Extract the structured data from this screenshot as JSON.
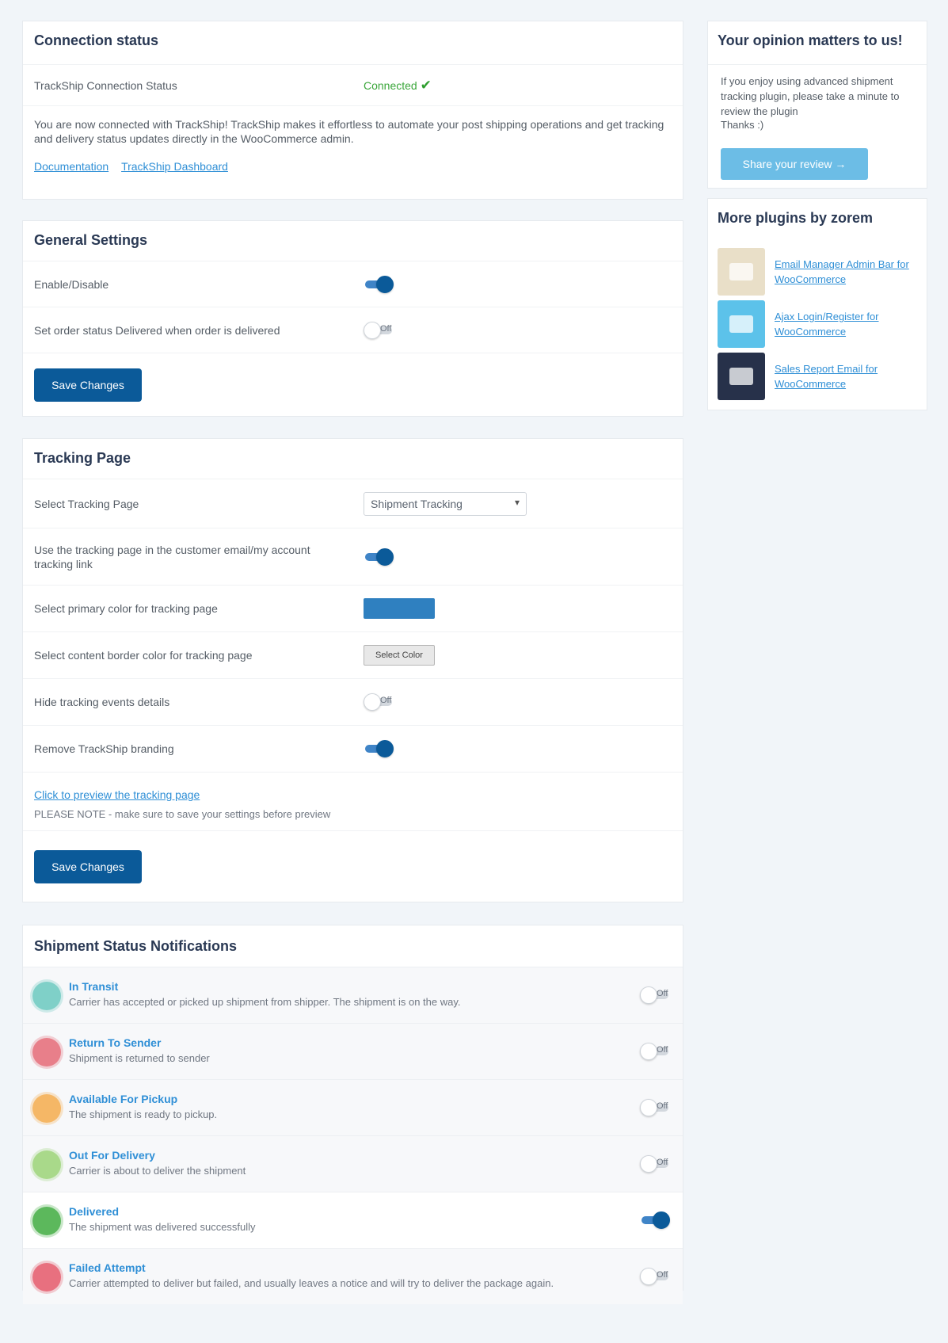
{
  "connection": {
    "title": "Connection status",
    "status_label": "TrackShip Connection Status",
    "status_value": "Connected",
    "description": "You are now connected with TrackShip! TrackShip makes it effortless to automate your post shipping operations and get tracking and delivery status updates directly in the WooCommerce admin.",
    "links": [
      "Documentation",
      "TrackShip Dashboard"
    ]
  },
  "general": {
    "title": "General Settings",
    "rows": [
      {
        "label": "Enable/Disable",
        "on": true
      },
      {
        "label": "Set order status Delivered when order is delivered",
        "on": false
      }
    ],
    "save_label": "Save Changes",
    "off_text": "Off"
  },
  "tracking": {
    "title": "Tracking Page",
    "select_label": "Select Tracking Page",
    "select_value": "Shipment Tracking",
    "use_page_label": "Use the tracking page in the customer email/my account tracking link",
    "primary_color_label": "Select primary color for tracking page",
    "primary_color": "#2f80c0",
    "border_color_label": "Select content border color for tracking page",
    "border_color_text": "Select Color",
    "hide_events_label": "Hide tracking events details",
    "remove_branding_label": "Remove TrackShip branding",
    "preview_link": "Click to preview the tracking page",
    "preview_note": "PLEASE NOTE - make sure to save your settings before preview",
    "save_label": "Save Changes",
    "off_text": "Off"
  },
  "notifications": {
    "title": "Shipment Status Notifications",
    "items": [
      {
        "title": "In Transit",
        "desc": "Carrier has accepted or picked up shipment from shipper. The shipment is on the way.",
        "color": "#7fd0c8",
        "on": false
      },
      {
        "title": "Return To Sender",
        "desc": "Shipment is returned to sender",
        "color": "#e87f8a",
        "on": false
      },
      {
        "title": "Available For Pickup",
        "desc": "The shipment is ready to pickup.",
        "color": "#f5b766",
        "on": false
      },
      {
        "title": "Out For Delivery",
        "desc": "Carrier is about to deliver the shipment",
        "color": "#a9d98a",
        "on": false
      },
      {
        "title": "Delivered",
        "desc": "The shipment was delivered successfully",
        "color": "#5cb85c",
        "on": true
      },
      {
        "title": "Failed Attempt",
        "desc": "Carrier attempted to deliver but failed, and usually leaves a notice and will try to deliver the package again.",
        "color": "#e8707f",
        "on": false
      }
    ],
    "off_text": "Off"
  },
  "opinion": {
    "title": "Your opinion matters to us!",
    "text": "If you enjoy using advanced shipment tracking plugin, please take a minute to review the plugin",
    "thanks": "Thanks :)",
    "button": "Share your review →"
  },
  "more_plugins": {
    "title": "More plugins by zorem",
    "items": [
      {
        "name": "Email Manager Admin Bar for WooCommerce",
        "bg": "#e9dfc8"
      },
      {
        "name": "Ajax Login/Register for WooCommerce",
        "bg": "#5cc2ea"
      },
      {
        "name": "Sales Report Email for WooCommerce",
        "bg": "#27314a"
      }
    ]
  }
}
